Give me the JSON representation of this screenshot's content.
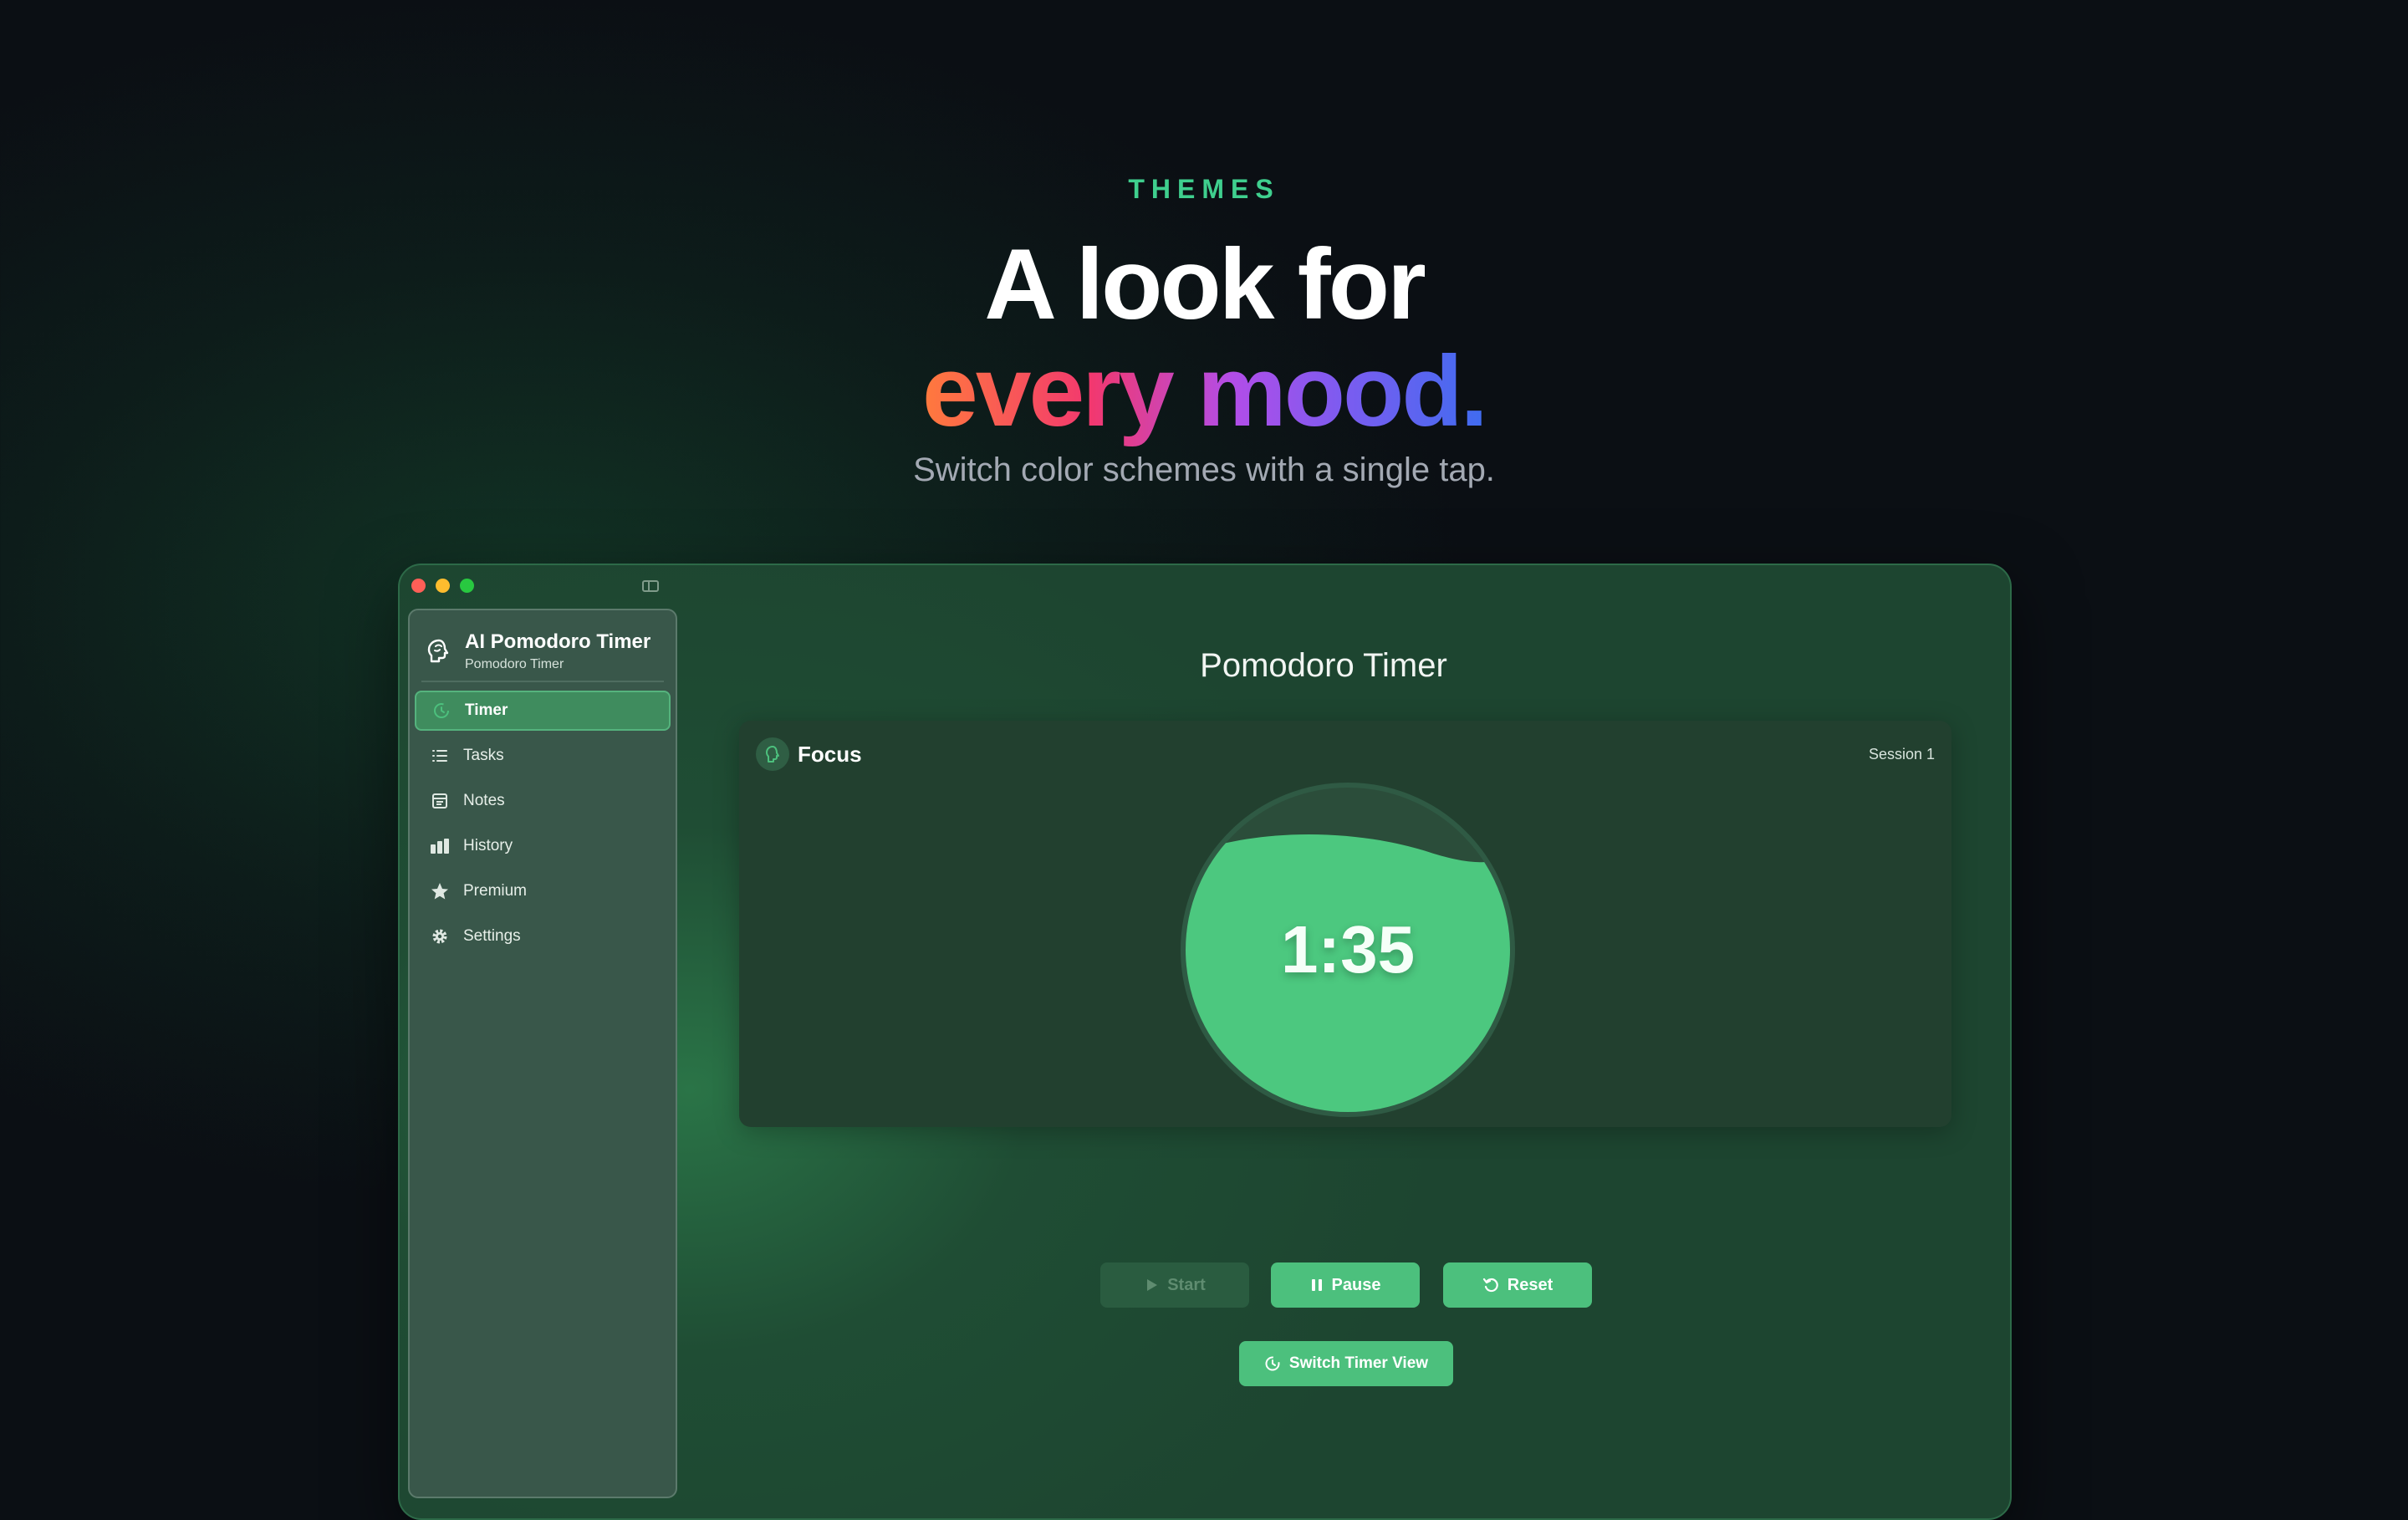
{
  "hero": {
    "eyebrow": "THEMES",
    "headline_line1": "A look for",
    "headline_line2": "every mood.",
    "subtitle": "Switch color schemes with a single tap."
  },
  "app": {
    "title": "AI Pomodoro Timer",
    "subtitle": "Pomodoro Timer"
  },
  "sidebar": {
    "items": [
      {
        "label": "Timer",
        "icon": "timer-icon",
        "active": true
      },
      {
        "label": "Tasks",
        "icon": "list-icon",
        "active": false
      },
      {
        "label": "Notes",
        "icon": "notes-icon",
        "active": false
      },
      {
        "label": "History",
        "icon": "bar-chart-icon",
        "active": false
      },
      {
        "label": "Premium",
        "icon": "star-icon",
        "active": false
      },
      {
        "label": "Settings",
        "icon": "gear-icon",
        "active": false
      }
    ]
  },
  "main": {
    "page_title": "Pomodoro Timer",
    "mode": "Focus",
    "session": "Session 1",
    "time": "1:35",
    "progress_fill": 0.83
  },
  "controls": {
    "start_label": "Start",
    "pause_label": "Pause",
    "reset_label": "Reset",
    "switch_label": "Switch Timer View"
  },
  "colors": {
    "accent": "#4cc07d",
    "eyebrow": "#3fcf8e",
    "gradient": [
      "#ff7a3d",
      "#f2386f",
      "#b24de8",
      "#3f6cf0"
    ]
  }
}
